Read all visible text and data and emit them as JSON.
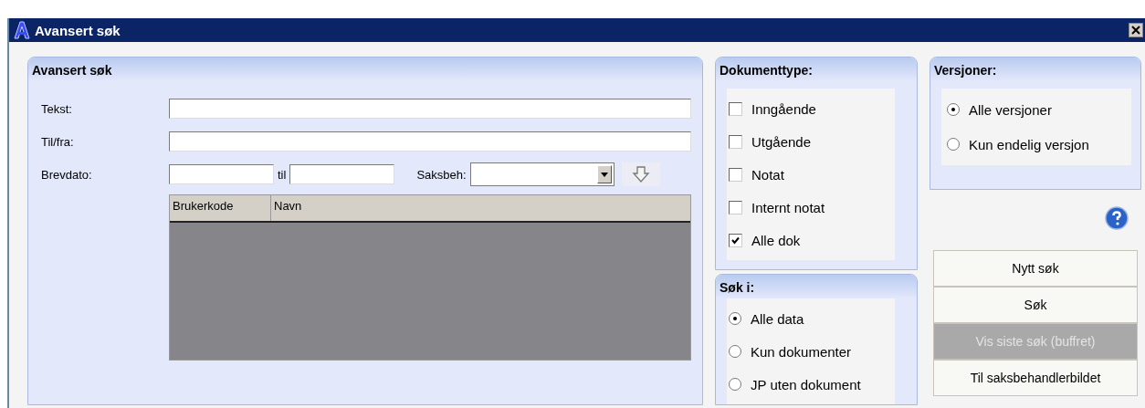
{
  "window": {
    "title": "Avansert søk"
  },
  "search_panel": {
    "title": "Avansert søk",
    "text_fields": [
      {
        "label": "Tekst:"
      },
      {
        "label": "Til/fra:"
      }
    ],
    "date_label": "Brevdato:",
    "date_separator": "til",
    "handler_label": "Saksbeh:",
    "table": {
      "columns": [
        "Brukerkode",
        "Navn"
      ]
    }
  },
  "document_type": {
    "title": "Dokumenttype:",
    "options": [
      {
        "label": "Inngående",
        "checked": false
      },
      {
        "label": "Utgående",
        "checked": false
      },
      {
        "label": "Notat",
        "checked": false
      },
      {
        "label": "Internt notat",
        "checked": false
      },
      {
        "label": "Alle dok",
        "checked": true
      }
    ]
  },
  "search_in": {
    "title": "Søk i:",
    "options": [
      {
        "label": "Alle data",
        "selected": true
      },
      {
        "label": "Kun dokumenter",
        "selected": false
      },
      {
        "label": "JP uten dokument",
        "selected": false
      }
    ]
  },
  "versions": {
    "title": "Versjoner:",
    "options": [
      {
        "label": "Alle versjoner",
        "selected": true
      },
      {
        "label": "Kun endelig versjon",
        "selected": false
      }
    ]
  },
  "buttons": [
    {
      "label": "Nytt søk",
      "disabled": false
    },
    {
      "label": "Søk",
      "disabled": false
    },
    {
      "label": "Vis siste søk (buffret)",
      "disabled": true
    },
    {
      "label": "Til saksbehandlerbildet",
      "disabled": false
    }
  ]
}
